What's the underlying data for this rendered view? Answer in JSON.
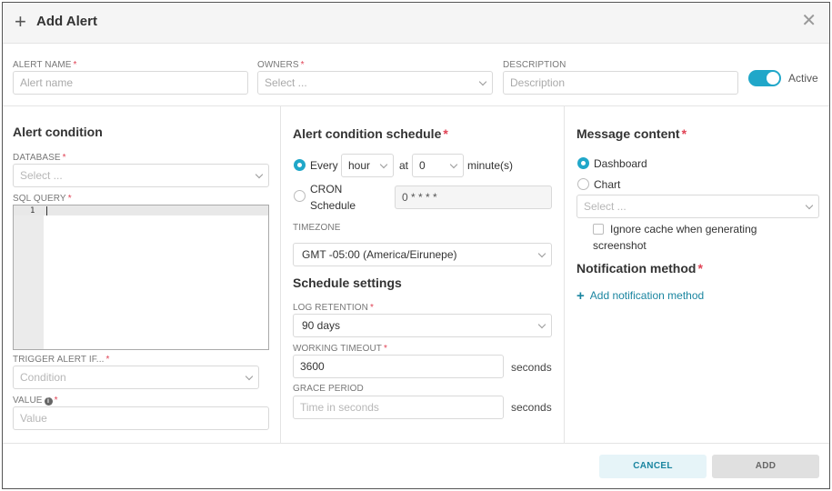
{
  "header": {
    "title": "Add Alert"
  },
  "top": {
    "alert_name_label": "ALERT NAME",
    "alert_name_placeholder": "Alert name",
    "owners_label": "OWNERS",
    "owners_placeholder": "Select ...",
    "description_label": "DESCRIPTION",
    "description_placeholder": "Description",
    "active_label": "Active"
  },
  "condition": {
    "title": "Alert condition",
    "database_label": "DATABASE",
    "database_placeholder": "Select ...",
    "sql_label": "SQL QUERY",
    "line_number": "1",
    "trigger_label": "TRIGGER ALERT IF...",
    "trigger_placeholder": "Condition",
    "value_label": "VALUE",
    "value_placeholder": "Value"
  },
  "schedule": {
    "title": "Alert condition schedule",
    "every_label": "Every",
    "unit_value": "hour",
    "at_label": "at",
    "minute_value": "0",
    "minutes_label": "minute(s)",
    "cron_label_1": "CRON",
    "cron_label_2": "Schedule",
    "cron_value": "0 * * * *",
    "timezone_label": "TIMEZONE",
    "timezone_value": "GMT -05:00 (America/Eirunepe)",
    "settings_title": "Schedule settings",
    "log_retention_label": "LOG RETENTION",
    "log_retention_value": "90 days",
    "working_timeout_label": "WORKING TIMEOUT",
    "working_timeout_value": "3600",
    "seconds_label": "seconds",
    "grace_label": "GRACE PERIOD",
    "grace_placeholder": "Time in seconds"
  },
  "message": {
    "title": "Message content",
    "dashboard_label": "Dashboard",
    "chart_label": "Chart",
    "select_placeholder": "Select ...",
    "ignore_cache_1": "Ignore cache when generating",
    "ignore_cache_2": "screenshot",
    "notification_title": "Notification method",
    "add_notification": "Add notification method"
  },
  "footer": {
    "cancel": "CANCEL",
    "add": "ADD"
  },
  "colors": {
    "accent": "#20a7c9",
    "required": "#e04355",
    "link": "#1a85a0"
  }
}
